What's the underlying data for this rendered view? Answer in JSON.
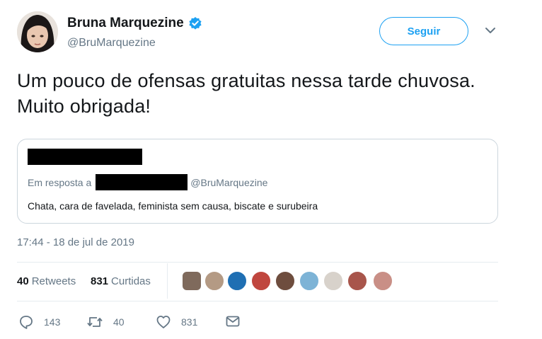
{
  "user": {
    "display_name": "Bruna Marquezine",
    "handle": "@BruMarquezine",
    "verified_icon": "verified-badge-icon"
  },
  "header": {
    "follow_label": "Seguir",
    "menu_icon": "chevron-down-icon"
  },
  "tweet": {
    "text": "Um pouco de ofensas gratuitas nessa tarde chuvosa. Muito obrigada!",
    "timestamp": "17:44 - 18 de jul de 2019"
  },
  "quote": {
    "reply_prefix": "Em resposta a",
    "reply_handle": "@BruMarquezine",
    "text": "Chata, cara de favelada, feminista sem causa, biscate e surubeira"
  },
  "stats": {
    "retweets_count": "40",
    "retweets_label": "Retweets",
    "likes_count": "831",
    "likes_label": "Curtidas"
  },
  "actions": {
    "replies": "143",
    "retweets": "40",
    "likes": "831"
  },
  "colors": {
    "accent": "#1da1f2",
    "muted": "#657786",
    "border": "#ccd6dd"
  }
}
